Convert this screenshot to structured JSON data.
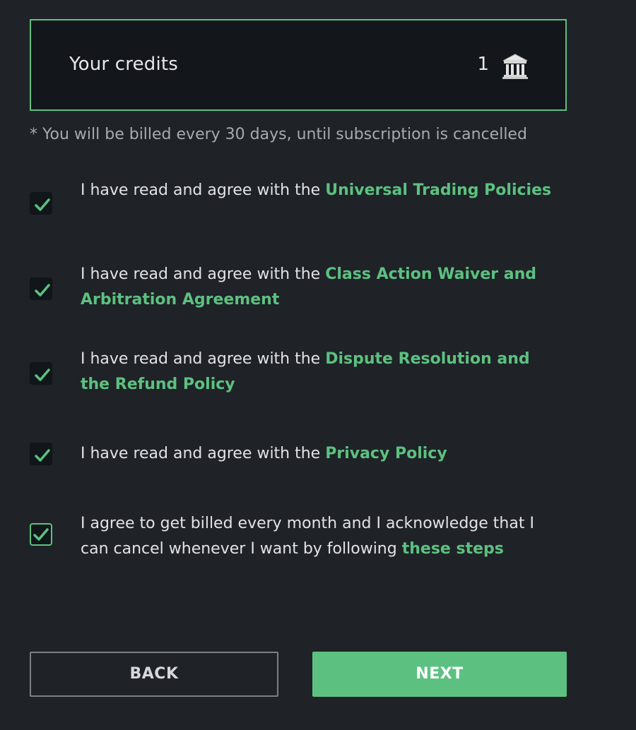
{
  "credits": {
    "label": "Your credits",
    "value": "1",
    "icon": "bank-icon"
  },
  "billing_note": "* You will be billed every 30 days, until subscription is cancelled",
  "agreements": [
    {
      "prefix": "I have read and agree with the ",
      "link": "Universal Trading Policies",
      "checked": true
    },
    {
      "prefix": "I have read and agree with the ",
      "link": "Class Action Waiver and Arbitration Agreement",
      "checked": true
    },
    {
      "prefix": "I have read and agree with the ",
      "link": "Dispute Resolution and the Refund Policy",
      "checked": true
    },
    {
      "prefix": "I have read and agree with the ",
      "link": "Privacy Policy",
      "checked": true
    },
    {
      "prefix": "I agree to get billed every month and I acknowledge that I can cancel whenever I want by following ",
      "link": "these steps",
      "checked": true
    }
  ],
  "buttons": {
    "back_label": "BACK",
    "next_label": "NEXT"
  },
  "colors": {
    "background": "#1f2227",
    "accent": "#5cc180",
    "panel": "#13161a"
  }
}
